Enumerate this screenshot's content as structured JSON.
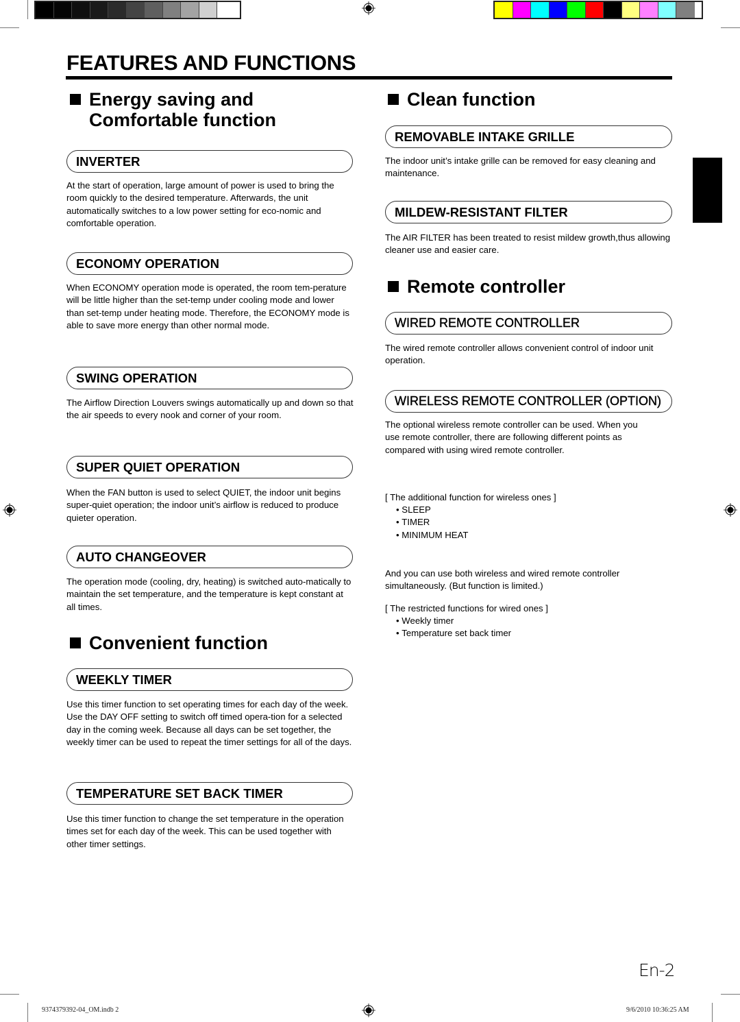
{
  "print_marks": {
    "gray_swatches": [
      "#000000",
      "#050505",
      "#0f0f0f",
      "#1a1a1a",
      "#2b2b2b",
      "#444444",
      "#5f5f5f",
      "#808080",
      "#a3a3a3",
      "#d0d0d0",
      "#ffffff"
    ],
    "color_swatches": [
      "#ffff00",
      "#ff00ff",
      "#00ffff",
      "#0000ff",
      "#00ff00",
      "#ff0000",
      "#000000",
      "#ffff80",
      "#ff80ff",
      "#80ffff",
      "#808080"
    ]
  },
  "page": {
    "title": "FEATURES AND FUNCTIONS",
    "page_number": "En-2"
  },
  "left": {
    "energy": {
      "heading": "Energy saving and\nComfortable function",
      "items": [
        {
          "title": "INVERTER",
          "body": "At the start of operation, large amount of power is used to bring the room quickly to the desired temperature. Afterwards, the unit automatically switches to a low power setting for eco-nomic and comfortable operation."
        },
        {
          "title": "ECONOMY OPERATION",
          "body": "When ECONOMY operation mode is operated, the room tem-perature will be little higher than the set-temp under cooling mode and lower than set-temp under heating mode. Therefore, the ECONOMY mode is able to save more energy than other normal mode."
        },
        {
          "title": "SWING OPERATION",
          "body": "The Airflow Direction Louvers swings automatically up and down so that the air speeds to every nook and corner of your room."
        },
        {
          "title": "SUPER QUIET OPERATION",
          "body": "When the FAN button is used to select QUIET, the indoor unit begins super-quiet operation; the indoor unit’s airflow is reduced to produce quieter operation."
        },
        {
          "title": "AUTO CHANGEOVER",
          "body": "The operation mode (cooling, dry, heating) is switched auto-matically to maintain the set temperature, and the temperature is kept constant at all times."
        }
      ]
    },
    "convenient": {
      "heading": "Convenient function",
      "items": [
        {
          "title": "WEEKLY TIMER",
          "body": "Use this timer function to set operating times for each day of the week. Use the DAY OFF setting to switch off timed opera-tion for a selected day in the coming week. Because all days can be set together, the weekly timer can be used to repeat the timer settings for all of the days."
        },
        {
          "title": "TEMPERATURE SET BACK TIMER",
          "body": "Use this timer function to change the set temperature in the operation times set for each day of the week. This can be used together with other timer settings."
        }
      ]
    }
  },
  "right": {
    "clean": {
      "heading": "Clean function",
      "items": [
        {
          "title": "REMOVABLE INTAKE GRILLE",
          "body": "The indoor unit’s intake grille can be removed for easy cleaning and maintenance."
        },
        {
          "title": "MILDEW-RESISTANT FILTER",
          "body": "The AIR FILTER has been treated to resist mildew growth,thus allowing cleaner use and easier care."
        }
      ]
    },
    "remote": {
      "heading": "Remote controller",
      "wired": {
        "title": "WIRED REMOTE CONTROLLER",
        "body": "The wired remote controller allows convenient control of indoor unit operation."
      },
      "wireless": {
        "title": "WIRELESS REMOTE CONTROLLER (OPTION)",
        "body": "The optional wireless remote controller can be used. When you use remote controller, there are following different points as compared with using wired remote controller.",
        "additional_label": "[ The additional function for wireless ones ]",
        "additional": [
          "SLEEP",
          "TIMER",
          "MINIMUM HEAT"
        ],
        "both_note": "And you can use both wireless and wired remote controller simultaneously. (But function is limited.)",
        "restricted_label": "[ The restricted functions for wired ones ]",
        "restricted": [
          "Weekly timer",
          "Temperature set back timer"
        ]
      }
    }
  },
  "footer": {
    "file": "9374379392-04_OM.indb   2",
    "timestamp": "9/6/2010   10:36:25 AM"
  }
}
